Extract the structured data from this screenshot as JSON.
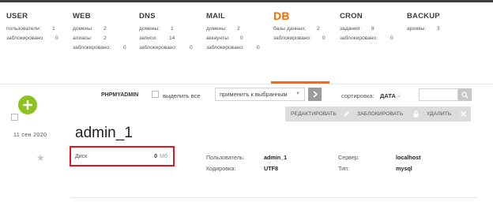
{
  "stats": {
    "user": {
      "title": "USER",
      "lines": [
        {
          "label": "пользователи:",
          "value": "1"
        },
        {
          "label": "заблокировано:",
          "value": "0"
        }
      ]
    },
    "web": {
      "title": "WEB",
      "lines": [
        {
          "label": "домены:",
          "value": "2"
        },
        {
          "label": "алиасы:",
          "value": "2"
        },
        {
          "label": "заблокировано:",
          "value": "0"
        }
      ]
    },
    "dns": {
      "title": "DNS",
      "lines": [
        {
          "label": "домены:",
          "value": "1"
        },
        {
          "label": "записи:",
          "value": "14"
        },
        {
          "label": "заблокировано:",
          "value": "0"
        }
      ]
    },
    "mail": {
      "title": "MAIL",
      "lines": [
        {
          "label": "домены:",
          "value": "2"
        },
        {
          "label": "аккаунты:",
          "value": "0"
        },
        {
          "label": "заблокировано:",
          "value": "0"
        }
      ]
    },
    "db": {
      "title": "DB",
      "lines": [
        {
          "label": "базы данных:",
          "value": "2"
        },
        {
          "label": "заблокировано:",
          "value": "0"
        }
      ]
    },
    "cron": {
      "title": "CRON",
      "lines": [
        {
          "label": "задания:",
          "value": "8"
        },
        {
          "label": "заблокировано:",
          "value": "0"
        }
      ]
    },
    "backup": {
      "title": "BACKUP",
      "lines": [
        {
          "label": "архивы:",
          "value": "3"
        }
      ]
    }
  },
  "toolbar": {
    "phpmyadmin": "PHPMYADMIN",
    "select_all": "выделить все",
    "apply_selected": "применить к выбранным",
    "sort_label": "сортировка:",
    "sort_value": "ДАТА",
    "sort_arrow": "↓"
  },
  "actions": {
    "edit": "РЕДАКТИРОВАТЬ",
    "block": "ЗАБЛОКИРОВАТЬ",
    "delete": "УДАЛИТЬ"
  },
  "database": {
    "date": "11 сен 2020",
    "name": "admin_1",
    "disk_label": "Диск",
    "disk_value": "0",
    "disk_unit": "Мб",
    "user_label": "Пользователь:",
    "user_value": "admin_1",
    "encoding_label": "Кодировка:",
    "encoding_value": "UTF8",
    "server_label": "Сервер:",
    "server_value": "localhost",
    "type_label": "Тип:",
    "type_value": "mysql"
  },
  "colors": {
    "accent": "#ff6701",
    "add_button": "#8dc21f",
    "highlight_border": "#e8141b"
  }
}
